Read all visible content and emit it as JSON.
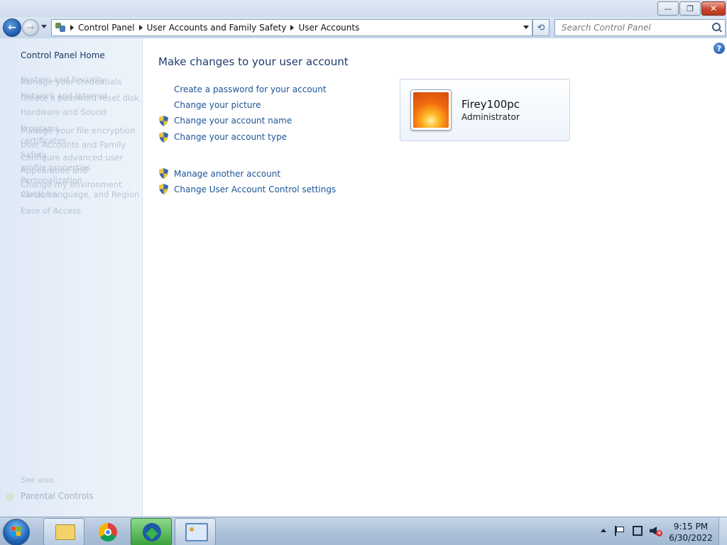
{
  "window": {
    "minimize_glyph": "—",
    "maximize_glyph": "❐",
    "close_glyph": "✕"
  },
  "navbar": {
    "back_glyph": "←",
    "forward_glyph": "→",
    "breadcrumbs": [
      "Control Panel",
      "User Accounts and Family Safety",
      "User Accounts"
    ],
    "refresh_glyph": "⟲",
    "search_placeholder": "Search Control Panel"
  },
  "sidebar": {
    "home_label": "Control Panel Home",
    "ghost_items": [
      "System and Security",
      "Manage your credentials",
      "Network and Internet",
      "Create a password reset disk",
      "Hardware and Sound",
      "Programs",
      "Manage your file encryption",
      "certificates",
      "User Accounts and Family",
      "Safety",
      "Configure advanced user",
      "profile properties",
      "Appearance and",
      "Personalization",
      "Change my environment",
      "variables",
      "Clock, Language, and Region",
      "Ease of Access"
    ],
    "see_also": "See also",
    "parental_controls": "Parental Controls"
  },
  "main": {
    "help_glyph": "?",
    "title": "Make changes to your user account",
    "links": [
      "Create a password for your account",
      "Change your picture",
      "Change your account name",
      "Change your account type",
      "Manage another account",
      "Change User Account Control settings"
    ],
    "user": {
      "name": "Firey100pc",
      "role": "Administrator"
    }
  },
  "taskbar": {
    "clock_time": "9:15 PM",
    "clock_date": "6/30/2022"
  }
}
